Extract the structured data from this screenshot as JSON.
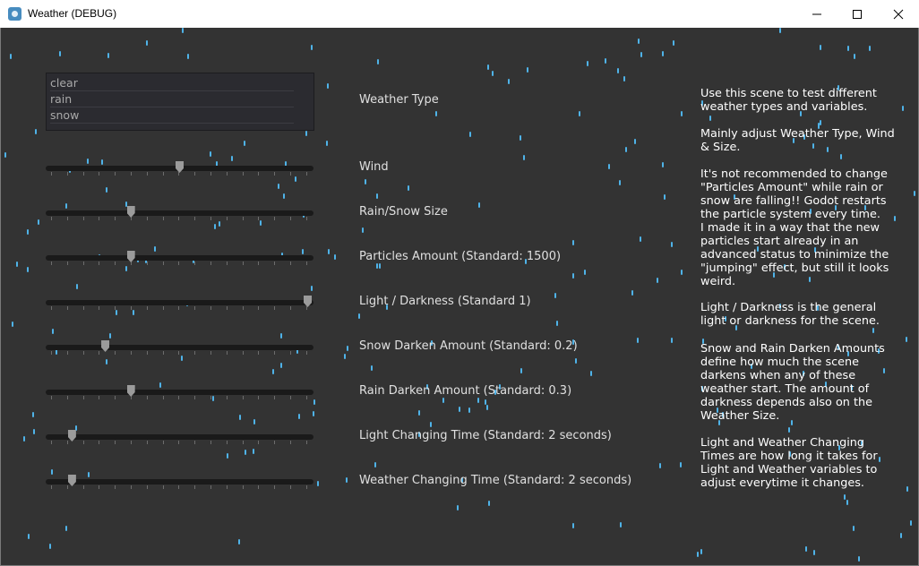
{
  "window": {
    "title": "Weather (DEBUG)"
  },
  "weather_list": {
    "items": [
      "clear",
      "rain",
      "snow"
    ]
  },
  "controls": [
    {
      "label": "Weather Type"
    },
    {
      "label": "Wind",
      "value": 0.5
    },
    {
      "label": "Rain/Snow Size",
      "value": 0.31
    },
    {
      "label": "Particles Amount (Standard: 1500)",
      "value": 0.31
    },
    {
      "label": "Light / Darkness (Standard 1)",
      "value": 1.0
    },
    {
      "label": "Snow Darken Amount (Standard: 0.2)",
      "value": 0.21
    },
    {
      "label": "Rain Darken Amount (Standard: 0.3)",
      "value": 0.31
    },
    {
      "label": "Light Changing Time (Standard: 2 seconds)",
      "value": 0.08
    },
    {
      "label": "Weather Changing Time (Standard: 2 seconds)",
      "value": 0.08
    }
  ],
  "help_text": {
    "p1": "Use this scene to test different weather types and variables.",
    "p2": "Mainly adjust Weather Type, Wind & Size.",
    "p3": "It's not recommended to change \"Particles Amount\" while rain or snow are falling!!  Godot restarts the particle system every time.\nI made it in a way that the new particles start already in an advanced status to minimize the \"jumping\" effect, but still it looks weird.",
    "p4": "Light / Darkness is the general light or darkness for the scene.",
    "p5": "Snow and Rain Darken Amounts define how much the scene darkens when any of these weather start. The amount of darkness depends also on the Weather Size.",
    "p6": "Light and Weather Changing Times are how long it takes for Light and Weather variables to adjust everytime it changes."
  },
  "colors": {
    "background": "#333333",
    "raindrop": "#4fb3e8",
    "text": "#e0e0e0",
    "help_text": "#ffffff"
  },
  "icons": {
    "app": "godot-icon",
    "minimize": "minimize-icon",
    "maximize": "maximize-icon",
    "close": "close-icon"
  }
}
